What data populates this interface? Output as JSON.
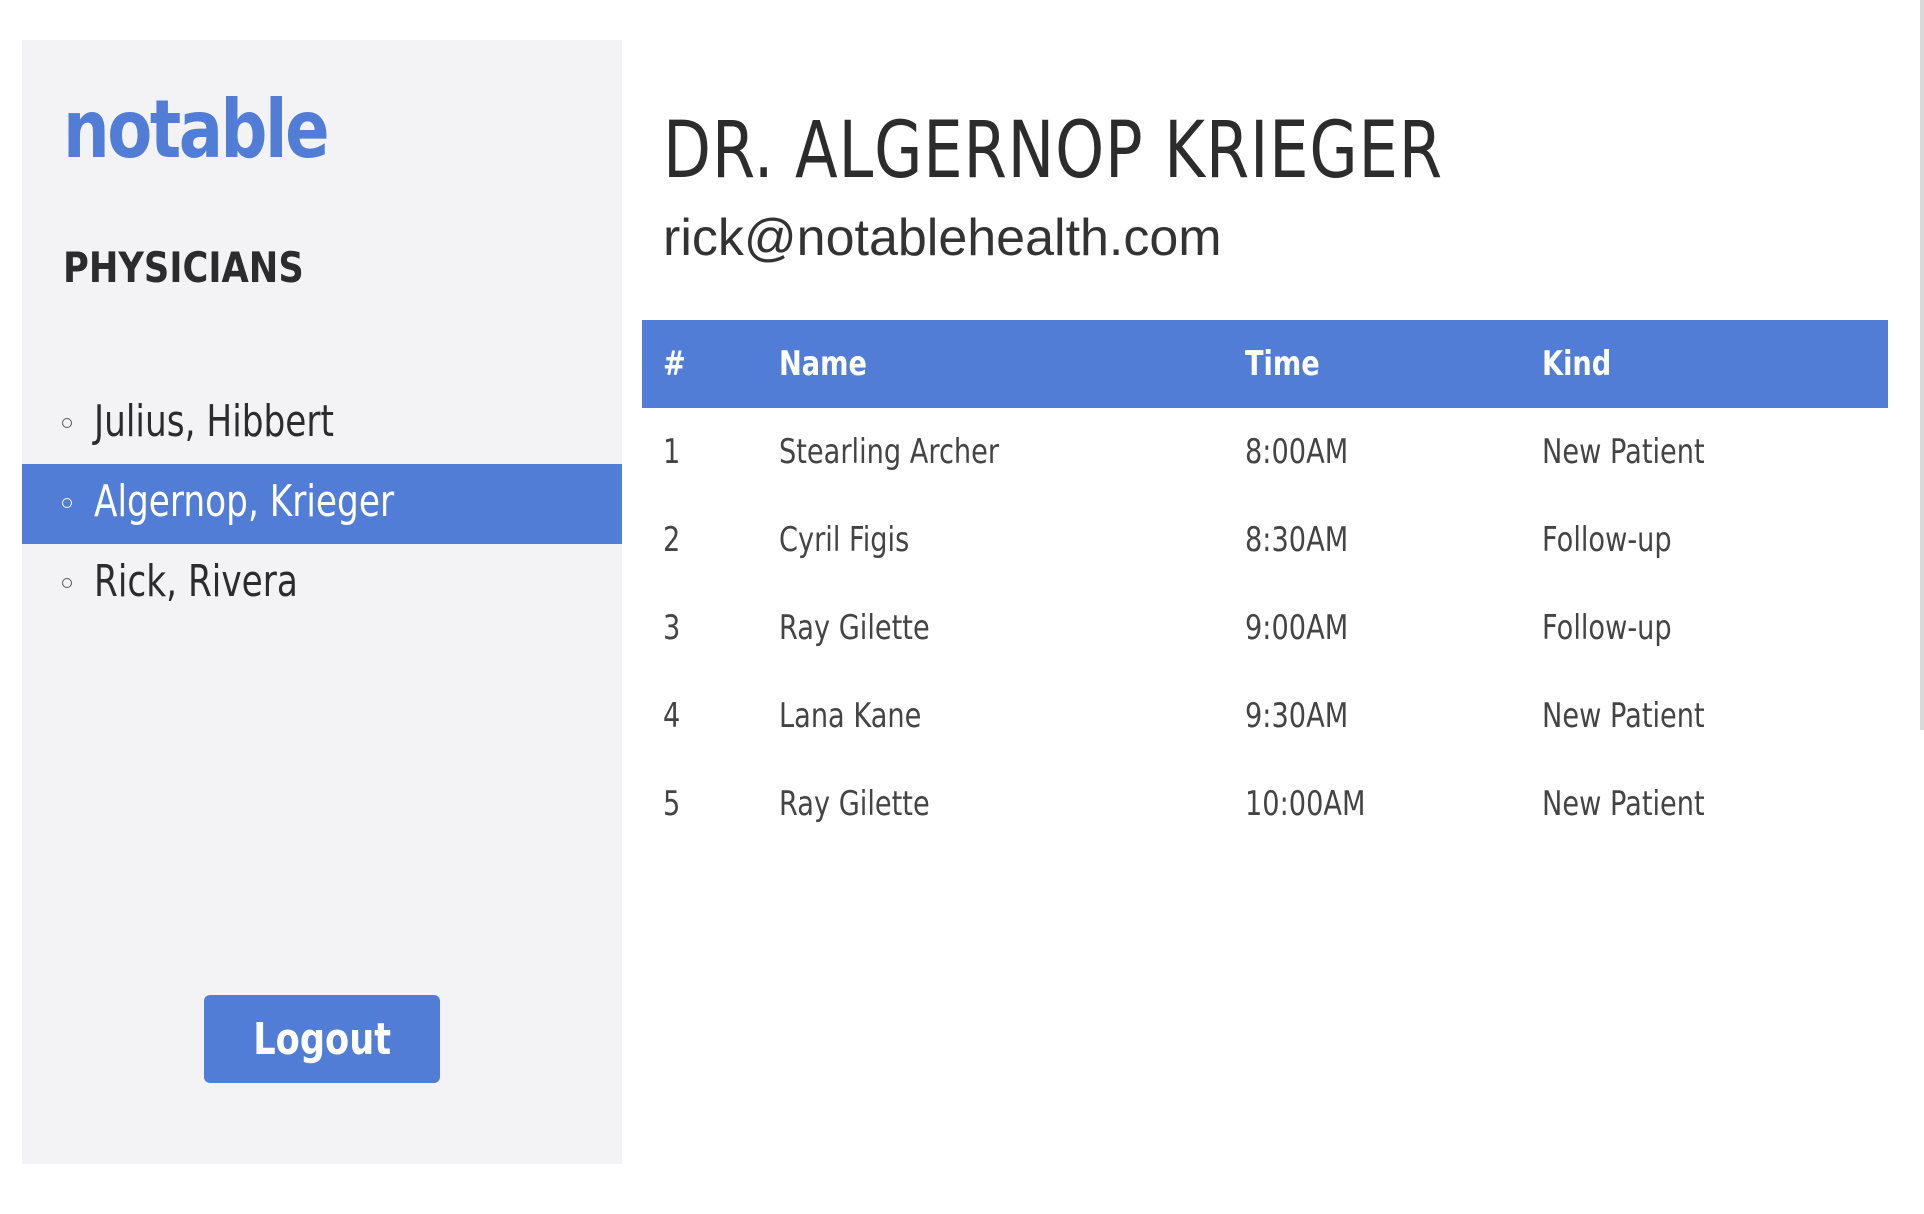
{
  "sidebar": {
    "logo": "notable",
    "section_title": "PHYSICIANS",
    "physicians": [
      {
        "label": "Julius, Hibbert",
        "active": false
      },
      {
        "label": "Algernop, Krieger",
        "active": true
      },
      {
        "label": "Rick, Rivera",
        "active": false
      }
    ],
    "logout_label": "Logout"
  },
  "main": {
    "doctor_name": "DR. ALGERNOP KRIEGER",
    "doctor_email": "rick@notablehealth.com",
    "table": {
      "headers": [
        "#",
        "Name",
        "Time",
        "Kind"
      ],
      "rows": [
        {
          "num": "1",
          "name": "Stearling Archer",
          "time": "8:00AM",
          "kind": "New Patient"
        },
        {
          "num": "2",
          "name": "Cyril Figis",
          "time": "8:30AM",
          "kind": "Follow-up"
        },
        {
          "num": "3",
          "name": "Ray Gilette",
          "time": "9:00AM",
          "kind": "Follow-up"
        },
        {
          "num": "4",
          "name": "Lana Kane",
          "time": "9:30AM",
          "kind": "New Patient"
        },
        {
          "num": "5",
          "name": "Ray Gilette",
          "time": "10:00AM",
          "kind": "New Patient"
        }
      ]
    }
  },
  "colors": {
    "accent": "#527dd6",
    "sidebar_bg": "#f3f3f6",
    "text_dark": "#2c2c2c"
  }
}
